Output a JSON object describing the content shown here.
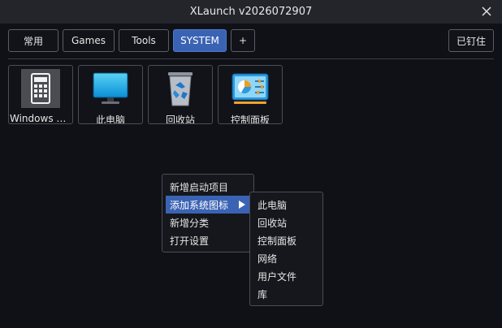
{
  "window": {
    "title": "XLaunch v2026072907"
  },
  "tabs": [
    {
      "label": "常用"
    },
    {
      "label": "Games"
    },
    {
      "label": "Tools"
    },
    {
      "label": "SYSTEM"
    },
    {
      "label": "+"
    }
  ],
  "pin_label": "已钉住",
  "tiles": [
    {
      "label": "Windows C...",
      "icon": "calculator-icon"
    },
    {
      "label": "此电脑",
      "icon": "monitor-icon"
    },
    {
      "label": "回收站",
      "icon": "recycle-bin-icon"
    },
    {
      "label": "控制面板",
      "icon": "control-panel-icon"
    }
  ],
  "context_menu": {
    "items": [
      {
        "label": "新增启动项目"
      },
      {
        "label": "添加系统图标"
      },
      {
        "label": "新增分类"
      },
      {
        "label": "打开设置"
      }
    ]
  },
  "submenu": {
    "items": [
      {
        "label": "此电脑"
      },
      {
        "label": "回收站"
      },
      {
        "label": "控制面板"
      },
      {
        "label": "网络"
      },
      {
        "label": "用户文件"
      },
      {
        "label": "库"
      }
    ]
  },
  "colors": {
    "accent": "#3b63b4",
    "background": "#0f1117",
    "titlebar": "#23252b"
  }
}
